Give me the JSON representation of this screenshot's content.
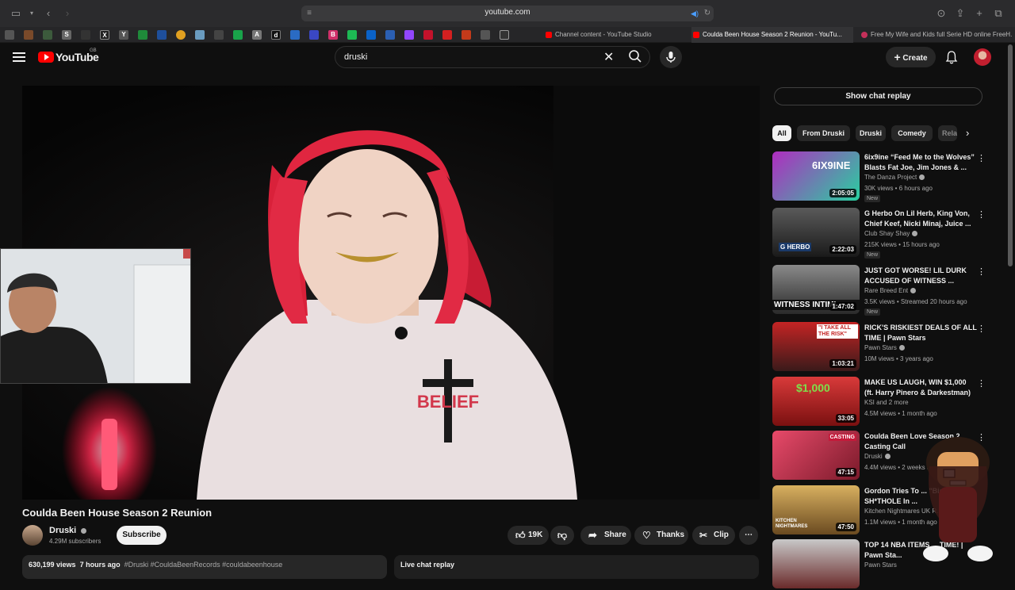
{
  "browser": {
    "url": "youtube.com",
    "tabs": [
      {
        "label": "Channel content - YouTube Studio"
      },
      {
        "label": "Coulda Been House Season 2 Reunion - YouTu..."
      },
      {
        "label": "Free My Wife and Kids full Serie HD online FreeH..."
      }
    ],
    "bookmarks": [
      "S",
      "X",
      "Y",
      "A",
      "d",
      "B"
    ]
  },
  "yt": {
    "logo": "YouTube",
    "region": "GB",
    "search_value": "druski",
    "create_label": "Create"
  },
  "video": {
    "title": "Coulda Been House Season 2 Reunion",
    "channel": "Druski",
    "subscribers": "4.29M subscribers",
    "subscribe_label": "Subscribe",
    "likes": "19K",
    "share_label": "Share",
    "thanks_label": "Thanks",
    "clip_label": "Clip",
    "views": "630,199 views",
    "age": "7 hours ago",
    "tags": "#Druski #CouldaBeenRecords #couldabeenhouse",
    "live_chat_label": "Live chat replay",
    "shirt_text": "BELIEF"
  },
  "sidebar": {
    "chat_replay_label": "Show chat replay",
    "chips": [
      "All",
      "From Druski",
      "Druski",
      "Comedy",
      "Rela"
    ],
    "recommendations": [
      {
        "title": "6ix9ine “Feed Me to the Wolves” Blasts Fat Joe, Jim Jones & ...",
        "channel": "The Danza Project",
        "meta": "30K views • 6 hours ago",
        "badge": "New",
        "duration": "2:05:05",
        "thumb_text": "6IX9INE"
      },
      {
        "title": "G Herbo On Lil Herb, King Von, Chief Keef, Nicki Minaj, Juice ...",
        "channel": "Club Shay Shay",
        "meta": "215K views • 15 hours ago",
        "badge": "New",
        "duration": "2:22:03",
        "thumb_text": "G HERBO"
      },
      {
        "title": "JUST GOT WORSE! LIL DURK ACCUSED OF WITNESS ...",
        "channel": "Rare Breed Ent",
        "meta": "3.5K views • Streamed 20 hours ago",
        "badge": "New",
        "duration": "1:47:02",
        "thumb_text": "WITNESS INTIMI"
      },
      {
        "title": "RICK'S RISKIEST DEALS OF ALL TIME | Pawn Stars",
        "channel": "Pawn Stars",
        "meta": "10M views • 3 years ago",
        "badge": "",
        "duration": "1:03:21",
        "thumb_text": "\"I TAKE ALL THE RISK\""
      },
      {
        "title": "MAKE US LAUGH, WIN $1,000 (ft. Harry Pinero & Darkestman)",
        "channel": "KSI and 2 more",
        "meta": "4.5M views • 1 month ago",
        "badge": "",
        "duration": "33:05",
        "thumb_text": "$1,000"
      },
      {
        "title": "Coulda Been Love Season 2 Casting Call",
        "channel": "Druski",
        "meta": "4.4M views • 2 weeks ago",
        "badge": "",
        "duration": "47:15",
        "thumb_text": "CASTING"
      },
      {
        "title": "Gordon Tries To ... \"Biggest SH*THOLE In ...",
        "channel": "Kitchen Nightmares UK R...",
        "meta": "1.1M views • 1 month ago",
        "badge": "",
        "duration": "47:50",
        "thumb_text": "KITCHEN NIGHTMARES"
      },
      {
        "title": "TOP 14 NBA ITEMS ... TIME! | Pawn Sta...",
        "channel": "Pawn Stars",
        "meta": "",
        "badge": "",
        "duration": "",
        "thumb_text": ""
      }
    ]
  },
  "colors": {
    "yt_red": "#ff0000",
    "bg": "#0f0f0f",
    "chip_bg": "#272727",
    "text_secondary": "#aaaaaa"
  }
}
